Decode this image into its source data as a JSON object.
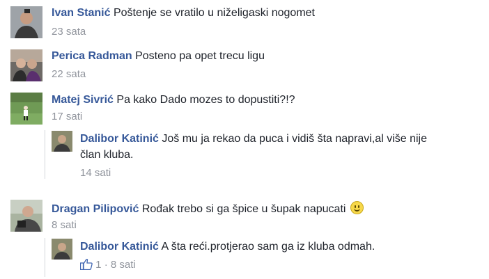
{
  "comments": [
    {
      "author": "Ivan Stanić",
      "text": "Poštenje se vratilo u niželigaski nogomet",
      "time": "23 sata"
    },
    {
      "author": "Perica Radman",
      "text": "Posteno pa opet trecu ligu",
      "time": "22 sata"
    },
    {
      "author": "Matej Sivrić",
      "text": "Pa kako Dado mozes to dopustiti?!?",
      "time": "17 sati",
      "reply": {
        "author": "Dalibor Katinić",
        "text": "Još mu ja rekao da puca i vidiš šta napravi,al više nije",
        "text2": "član kluba.",
        "time": "14 sati"
      }
    },
    {
      "author": "Dragan Pilipović",
      "text": "Rođak trebo si ga špice u šupak napucati",
      "time": "8 sati",
      "emoji": "smiley-icon",
      "reply": {
        "author": "Dalibor Katinić",
        "text": "A šta reći.protjerao sam ga iz kluba odmah.",
        "likes": "1",
        "separator": "·",
        "time": "8 sati"
      }
    }
  ],
  "colors": {
    "name": "#365899",
    "text": "#1d2129",
    "meta": "#90949c",
    "like": "#4267b2"
  }
}
